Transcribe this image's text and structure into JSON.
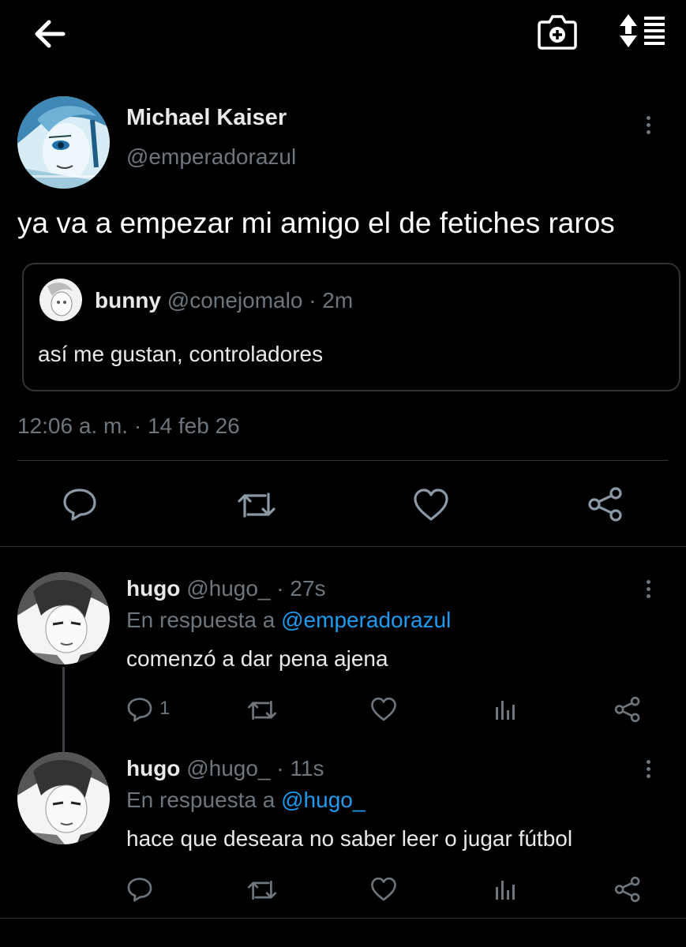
{
  "topbar": {
    "back_icon": "arrow-left-icon",
    "camera_icon": "camera-plus-icon",
    "sort_icon": "sort-lines-icon"
  },
  "tweet": {
    "author_name": "Michael Kaiser",
    "author_handle": "@emperadorazul",
    "text": "ya va a empezar mi amigo el de fetiches raros",
    "quote": {
      "name": "bunny",
      "handle": "@conejomalo",
      "time": "· 2m",
      "text": "así me gustan, controladores"
    },
    "timestamp": "12:06 a. m. · 14 feb 26",
    "actions": [
      "reply-icon",
      "retweet-icon",
      "like-icon",
      "share-icon"
    ]
  },
  "replies": [
    {
      "name": "hugo",
      "handle": "@hugo_",
      "time": "· 27s",
      "reply_prefix": "En respuesta a",
      "reply_to": "@emperadorazul",
      "text": "comenzó a dar pena ajena",
      "reply_count": "1"
    },
    {
      "name": "hugo",
      "handle": "@hugo_",
      "time": "· 11s",
      "reply_prefix": "En respuesta a",
      "reply_to": "@hugo_",
      "text": "hace que deseara no saber leer o jugar fútbol",
      "reply_count": ""
    }
  ],
  "colors": {
    "background": "#000000",
    "text": "#e7e9ea",
    "muted": "#6e767d",
    "accent": "#1d9bf0",
    "divider": "#2f3336"
  }
}
